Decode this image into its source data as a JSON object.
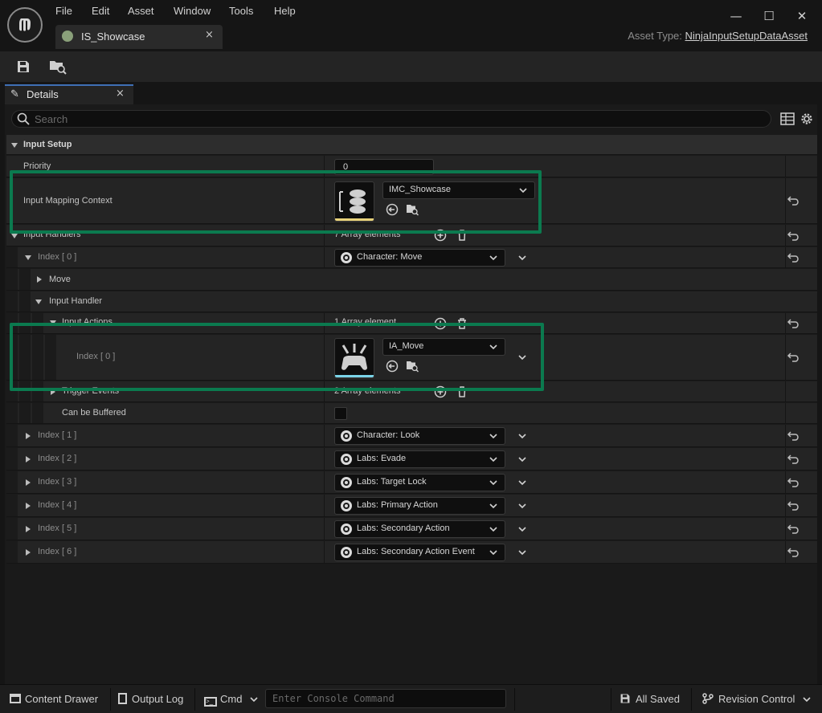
{
  "menu": [
    "File",
    "Edit",
    "Asset",
    "Window",
    "Tools",
    "Help"
  ],
  "document_tab": {
    "label": "IS_Showcase",
    "close": "×"
  },
  "window_controls": {
    "minimize": "—",
    "maximize": "☐",
    "close": "✕"
  },
  "asset_type": {
    "prefix": "Asset Type: ",
    "value": "NinjaInputSetupDataAsset"
  },
  "toolbar": {
    "save_icon": "save-icon",
    "browse_icon": "browse-to-asset-icon"
  },
  "details_tab": {
    "label": "Details",
    "close": "×"
  },
  "search": {
    "placeholder": "Search"
  },
  "details": {
    "category": "Input Setup",
    "priority": {
      "label": "Priority",
      "value": "0"
    },
    "input_mapping_context": {
      "label": "Input Mapping Context",
      "value": "IMC_Showcase"
    },
    "input_handlers": {
      "label": "Input Handlers",
      "count": "7 Array elements",
      "index0": {
        "label": "Index [ 0 ]",
        "value": "Character: Move",
        "move_label": "Move",
        "input_handler_label": "Input Handler",
        "input_actions": {
          "label": "Input Actions",
          "count": "1 Array element"
        },
        "action_index0": {
          "label": "Index [ 0 ]",
          "value": "IA_Move"
        },
        "trigger_events": {
          "label": "Trigger Events",
          "count": "2 Array elements"
        },
        "can_be_buffered": {
          "label": "Can be Buffered",
          "checked": false
        }
      },
      "items": [
        {
          "label": "Index [ 1 ]",
          "value": "Character: Look"
        },
        {
          "label": "Index [ 2 ]",
          "value": "Labs: Evade"
        },
        {
          "label": "Index [ 3 ]",
          "value": "Labs: Target Lock"
        },
        {
          "label": "Index [ 4 ]",
          "value": "Labs: Primary Action"
        },
        {
          "label": "Index [ 5 ]",
          "value": "Labs: Secondary Action"
        },
        {
          "label": "Index [ 6 ]",
          "value": "Labs: Secondary Action Event"
        }
      ]
    }
  },
  "statusbar": {
    "content_drawer": "Content Drawer",
    "output_log": "Output Log",
    "cmd": "Cmd",
    "console_placeholder": "Enter Console Command",
    "all_saved": "All Saved",
    "revision_control": "Revision Control"
  },
  "colors": {
    "accent_blue": "#3f6fb5",
    "highlight_green": "#0b7a4f",
    "imc_bar": "#e8d27a",
    "ia_bar": "#7ad4e8"
  }
}
